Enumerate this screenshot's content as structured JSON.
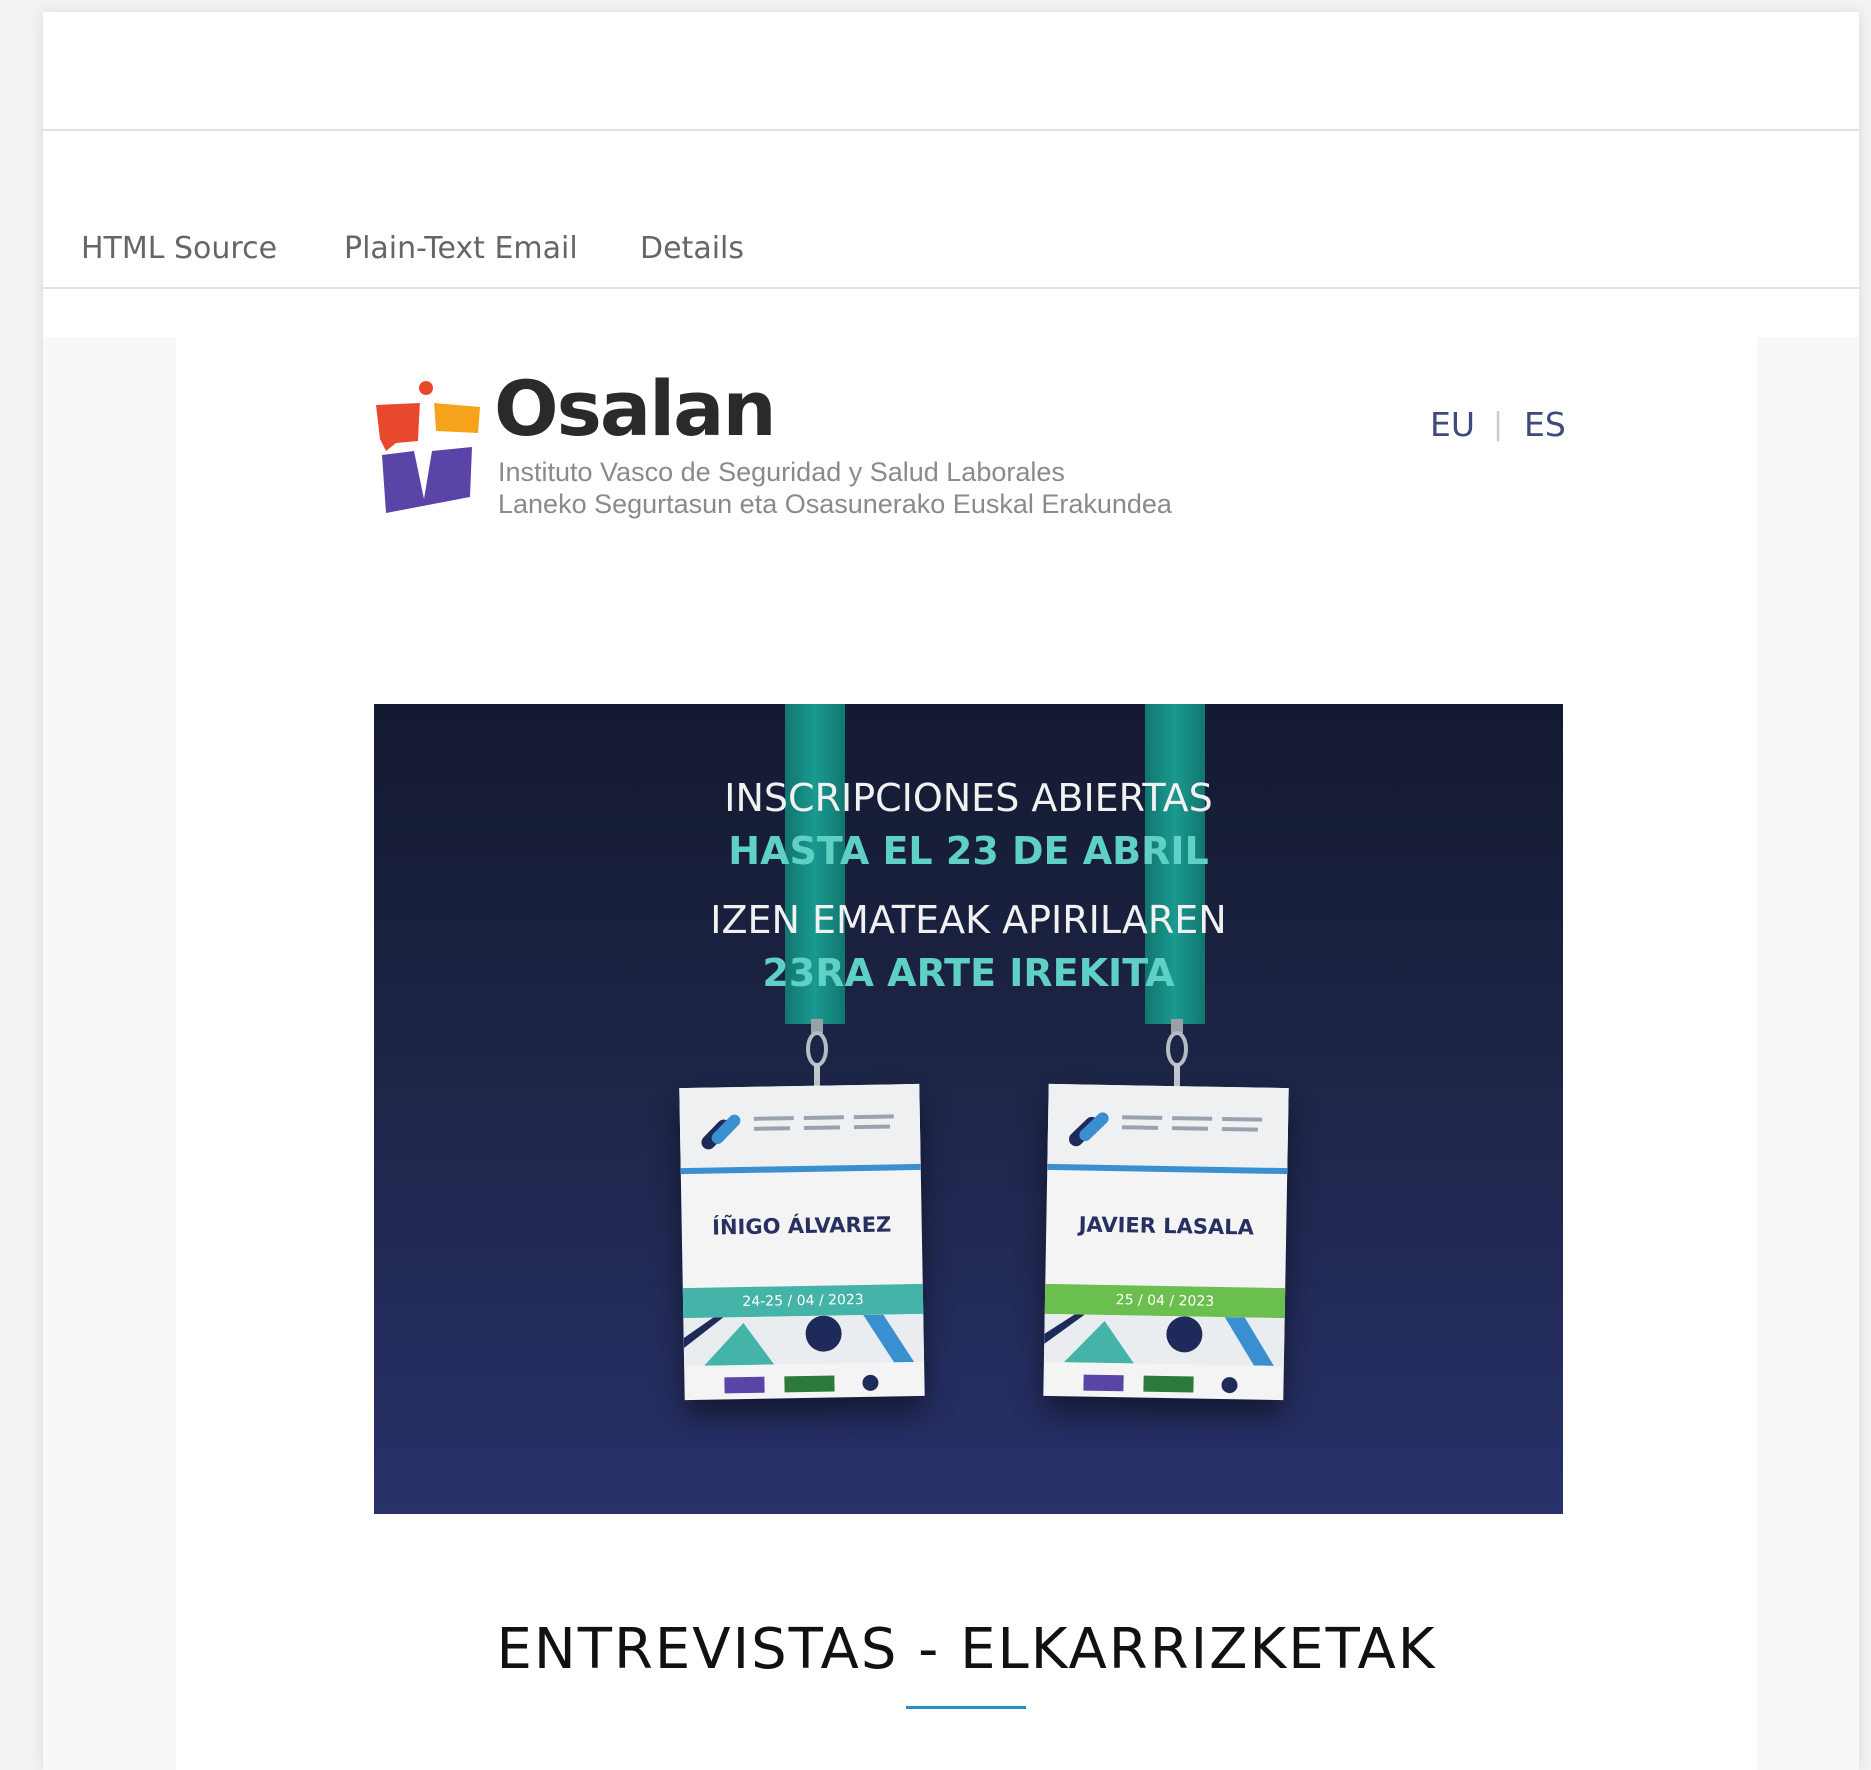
{
  "tabs": [
    {
      "label": "HTML Source"
    },
    {
      "label": "Plain-Text Email"
    },
    {
      "label": "Details"
    }
  ],
  "email": {
    "brand": {
      "name": "Osalan",
      "subtitle_es": "Instituto Vasco de Seguridad y Salud Laborales",
      "subtitle_eu": "Laneko Segurtasun eta Osasunerako Euskal Erakundea",
      "logo_colors": {
        "red": "#e8482c",
        "orange": "#f7a21b",
        "purple": "#5a44a8"
      }
    },
    "languages": [
      {
        "label": "EU"
      },
      {
        "label": "ES"
      }
    ],
    "language_separator": "|",
    "banner": {
      "line1": "INSCRIPCIONES ABIERTAS",
      "line2": "HASTA EL 23 DE ABRIL",
      "line3": "IZEN EMATEAK APIRILAREN",
      "line4": "23RA ARTE IREKITA",
      "badges": [
        {
          "name": "ÍÑIGO ÁLVAREZ",
          "dates": "24-25 / 04 / 2023",
          "band_color": "#44b3a8"
        },
        {
          "name": "JAVIER LASALA",
          "dates": "25 / 04 / 2023",
          "band_color": "#6bbf4f"
        }
      ]
    },
    "section_title": "ENTREVISTAS - ELKARRIZKETAK",
    "accent_color": "#2a8cc8"
  }
}
